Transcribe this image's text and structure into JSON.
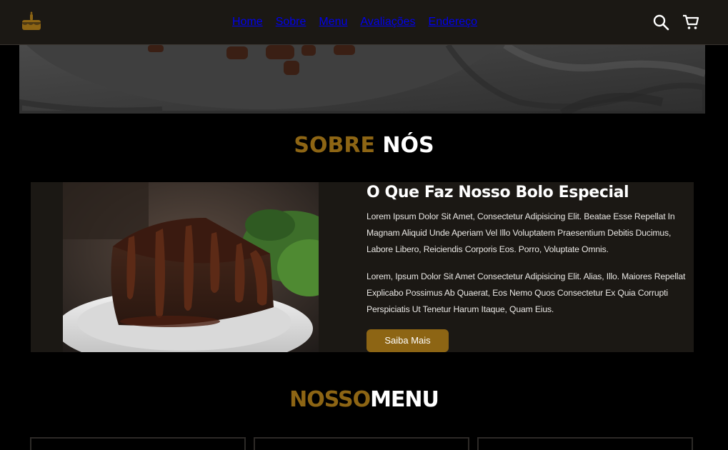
{
  "header": {
    "logo_icon": "cake-icon",
    "nav": [
      "Home",
      "Sobre",
      "Menu",
      "Avaliações",
      "Endereço"
    ],
    "search_icon": "search-icon",
    "cart_icon": "cart-icon"
  },
  "about": {
    "title_accent": "SOBRE",
    "title_main": "NÓS",
    "heading": "O Que Faz Nosso Bolo Especial",
    "paragraph_1": "Lorem Ipsum Dolor Sit Amet, Consectetur Adipisicing Elit. Beatae Esse Repellat In Magnam Aliquid Unde Aperiam Vel Illo Voluptatem Praesentium Debitis Ducimus, Labore Libero, Reiciendis Corporis Eos. Porro, Voluptate Omnis.",
    "paragraph_2": "Lorem, Ipsum Dolor Sit Amet Consectetur Adipisicing Elit. Alias, Illo. Maiores Repellat Explicabo Possimus Ab Quaerat, Eos Nemo Quos Consectetur Ex Quia Corrupti Perspiciatis Ut Tenetur Harum Itaque, Quam Eius.",
    "button": "Saiba Mais"
  },
  "menu": {
    "title_accent": "NOSSO",
    "title_main": "MENU"
  },
  "colors": {
    "accent": "#8d6514",
    "panel": "#1b1814",
    "background": "#000000"
  }
}
